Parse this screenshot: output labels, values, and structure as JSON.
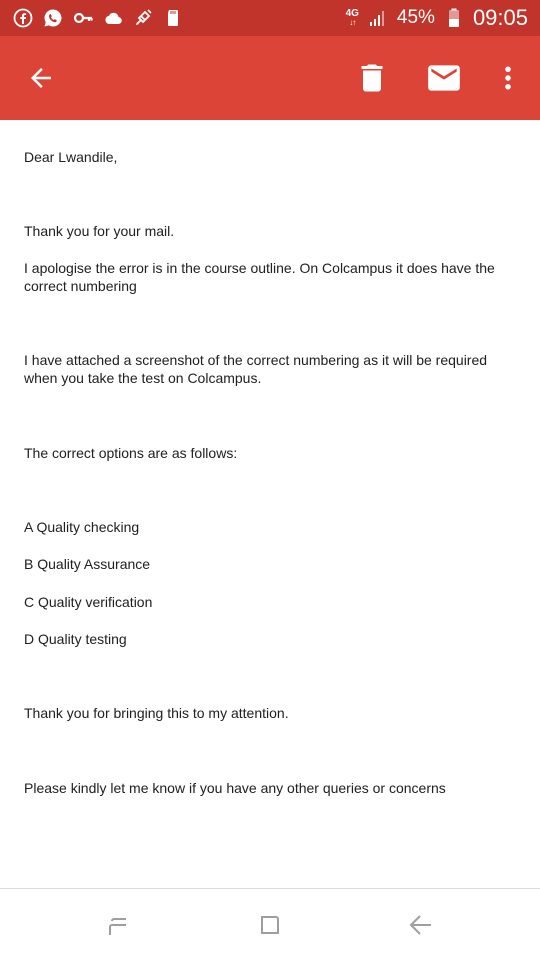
{
  "status_bar": {
    "network": "4G",
    "network_arrows": "↓↑",
    "battery": "45%",
    "time": "09:05",
    "icons": [
      "facebook-icon",
      "whatsapp-icon",
      "key-icon",
      "cloud-icon",
      "satellite-icon",
      "sd-card-icon",
      "signal-icon",
      "battery-icon"
    ]
  },
  "toolbar": {
    "icons": [
      "back-arrow-icon",
      "delete-icon",
      "mail-icon",
      "more-vert-icon"
    ]
  },
  "email": {
    "greeting": "Dear Lwandile,",
    "thanks": "Thank you for your mail.",
    "apology": "I apologise the error is in the course outline. On Colcampus it does have the correct numbering",
    "attachment_note": "I have attached a screenshot of the correct numbering as it will be required when you take the test on Colcampus.",
    "options_intro": "The correct options are as follows:",
    "options": [
      "A Quality checking",
      "B Quality Assurance",
      "C Quality verification",
      "D Quality testing"
    ],
    "closing_thanks": "Thank you for bringing this to my attention.",
    "closing_request": "Please kindly let me know if you have any other queries or concerns"
  },
  "nav_bar": {
    "icons": [
      "recent-apps-icon",
      "home-icon",
      "nav-back-icon"
    ]
  },
  "colors": {
    "status_bar": "#c1342c",
    "toolbar": "#db4437",
    "text": "#202020",
    "nav_icon": "#9e9e9e"
  }
}
